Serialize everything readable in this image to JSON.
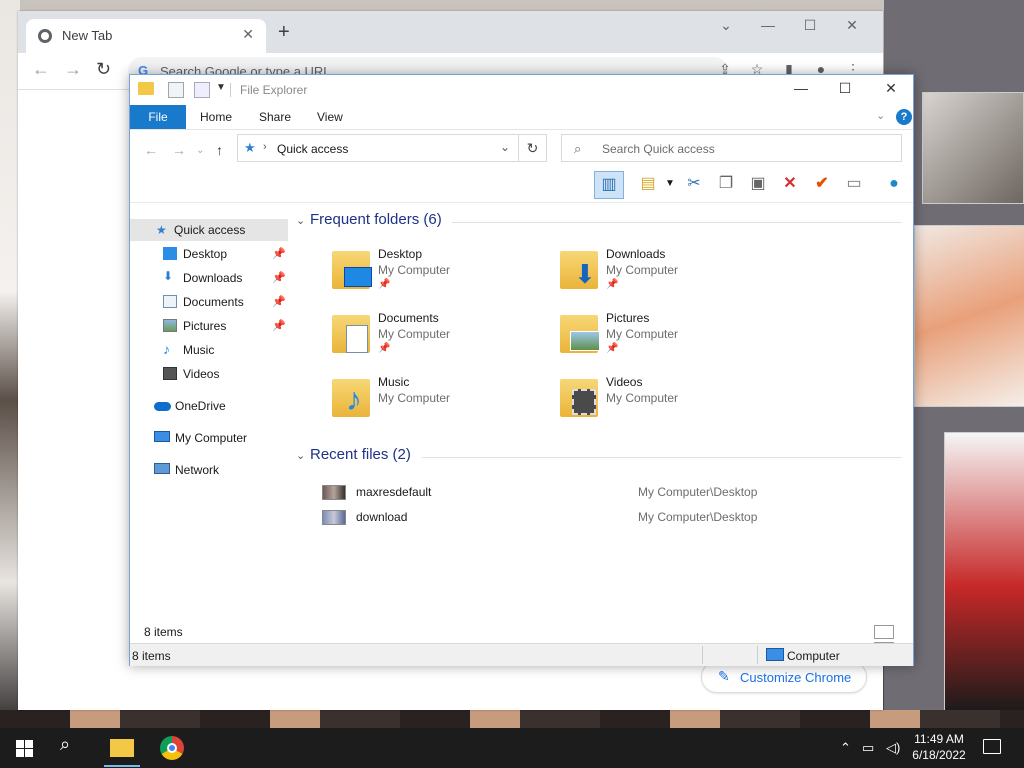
{
  "browser": {
    "tab_title": "New Tab",
    "new_tab": "+",
    "omnibox_placeholder": "Search Google or type a URL",
    "customize_label": "Customize Chrome",
    "window_controls": [
      "⌄",
      "—",
      "☐",
      "✕"
    ]
  },
  "explorer": {
    "title": "File Explorer",
    "ribbon_tabs": [
      "File",
      "Home",
      "Share",
      "View"
    ],
    "address": "Quick access",
    "search_placeholder": "Search Quick access",
    "nav": [
      {
        "label": "Quick access",
        "icon": "star-icon",
        "pinned": false,
        "selected": true
      },
      {
        "label": "Desktop",
        "icon": "desktop-icon",
        "pinned": true
      },
      {
        "label": "Downloads",
        "icon": "download-icon",
        "pinned": true
      },
      {
        "label": "Documents",
        "icon": "document-icon",
        "pinned": true
      },
      {
        "label": "Pictures",
        "icon": "pictures-icon",
        "pinned": true
      },
      {
        "label": "Music",
        "icon": "music-icon",
        "pinned": false
      },
      {
        "label": "Videos",
        "icon": "videos-icon",
        "pinned": false
      },
      {
        "label": "OneDrive",
        "icon": "cloud-icon",
        "pinned": false
      },
      {
        "label": "My Computer",
        "icon": "computer-icon",
        "pinned": false
      },
      {
        "label": "Network",
        "icon": "network-icon",
        "pinned": false
      }
    ],
    "frequent_header": "Frequent folders (6)",
    "folders": [
      {
        "name": "Desktop",
        "location": "My Computer",
        "pinned": true
      },
      {
        "name": "Downloads",
        "location": "My Computer",
        "pinned": true
      },
      {
        "name": "Documents",
        "location": "My Computer",
        "pinned": true
      },
      {
        "name": "Pictures",
        "location": "My Computer",
        "pinned": true
      },
      {
        "name": "Music",
        "location": "My Computer",
        "pinned": false
      },
      {
        "name": "Videos",
        "location": "My Computer",
        "pinned": false
      }
    ],
    "recent_header": "Recent files (2)",
    "recent": [
      {
        "name": "maxresdefault",
        "path": "My Computer\\Desktop"
      },
      {
        "name": "download",
        "path": "My Computer\\Desktop"
      }
    ],
    "item_count": "8 items",
    "status_left": "8 items",
    "status_right": "Computer",
    "accent": "#1979ca"
  },
  "taskbar": {
    "time": "11:49 AM",
    "date": "6/18/2022"
  }
}
